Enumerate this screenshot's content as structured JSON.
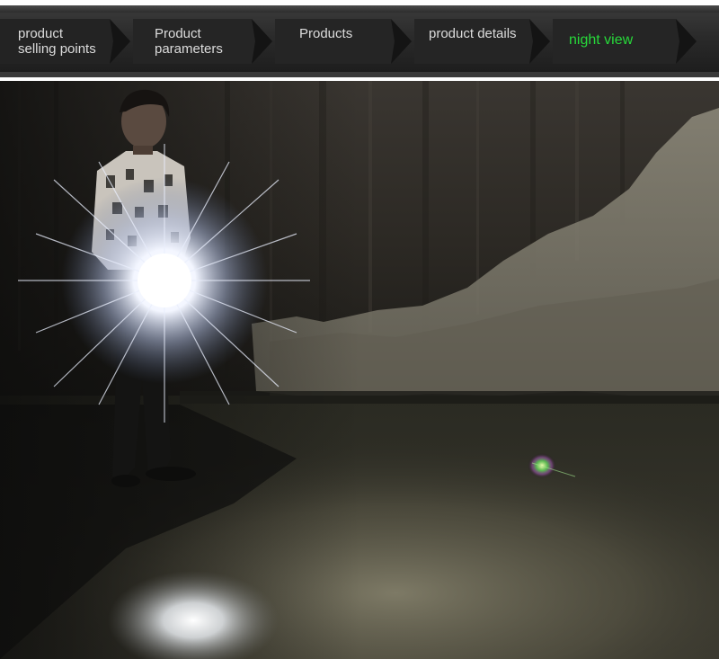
{
  "nav": {
    "tabs": [
      {
        "label": "product\nselling points",
        "active": false
      },
      {
        "label": "Product\nparameters",
        "active": false
      },
      {
        "label": "Products",
        "active": false
      },
      {
        "label": "product details",
        "active": false
      },
      {
        "label": "night view",
        "active": true
      }
    ]
  },
  "colors": {
    "active_tab_text": "#27d93a",
    "tab_text": "#dcdcdc",
    "tab_bg": "#262626",
    "nav_bg": "#2a2a2a"
  }
}
